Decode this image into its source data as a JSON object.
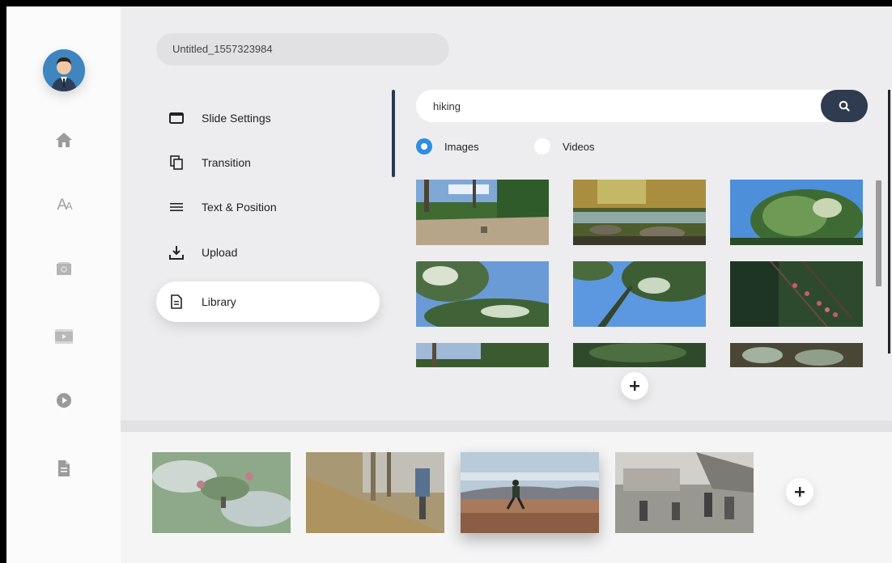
{
  "project": {
    "title": "Untitled_1557323984"
  },
  "menu": {
    "items": [
      {
        "label": "Slide Settings",
        "icon": "slide-icon"
      },
      {
        "label": "Transition",
        "icon": "transition-icon"
      },
      {
        "label": "Text & Position",
        "icon": "lines-icon"
      },
      {
        "label": "Upload",
        "icon": "upload-icon"
      },
      {
        "label": "Library",
        "icon": "document-icon",
        "active": true
      }
    ]
  },
  "rail": {
    "icons": [
      "user-avatar",
      "home-icon",
      "font-size-icon",
      "image-icon",
      "video-icon",
      "play-icon",
      "file-icon"
    ]
  },
  "search": {
    "value": "hiking"
  },
  "media_type": {
    "options": [
      "Images",
      "Videos"
    ],
    "selected": "Images"
  },
  "colors": {
    "accent": "#2f8ee0",
    "dark": "#2f3b4e"
  }
}
